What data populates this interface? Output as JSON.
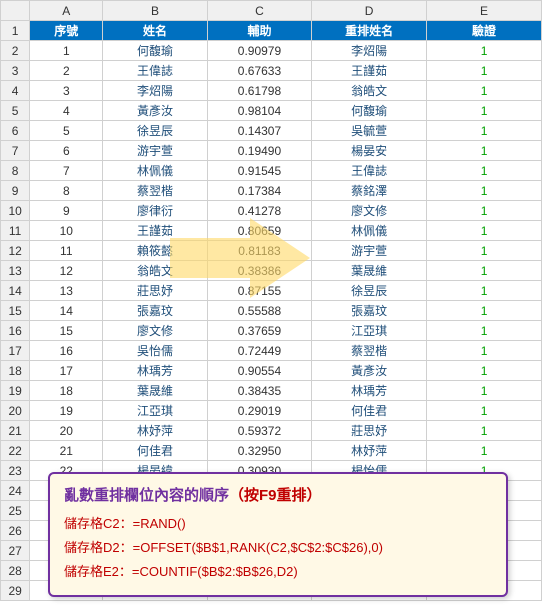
{
  "columns": [
    "A",
    "B",
    "C",
    "D",
    "E"
  ],
  "header": {
    "seq": "序號",
    "name": "姓名",
    "aux": "輔助",
    "reorder": "重排姓名",
    "verify": "驗證"
  },
  "rows": [
    {
      "r": 2,
      "seq": "1",
      "name": "何馥瑜",
      "aux": "0.90979",
      "reorder": "李炤陽",
      "verify": "1"
    },
    {
      "r": 3,
      "seq": "2",
      "name": "王偉誌",
      "aux": "0.67633",
      "reorder": "王謹茹",
      "verify": "1"
    },
    {
      "r": 4,
      "seq": "3",
      "name": "李炤陽",
      "aux": "0.61798",
      "reorder": "翁皓文",
      "verify": "1"
    },
    {
      "r": 5,
      "seq": "4",
      "name": "黃彥汝",
      "aux": "0.98104",
      "reorder": "何馥瑜",
      "verify": "1"
    },
    {
      "r": 6,
      "seq": "5",
      "name": "徐昱辰",
      "aux": "0.14307",
      "reorder": "吳毓萱",
      "verify": "1"
    },
    {
      "r": 7,
      "seq": "6",
      "name": "游宇萱",
      "aux": "0.19490",
      "reorder": "楊晏安",
      "verify": "1"
    },
    {
      "r": 8,
      "seq": "7",
      "name": "林佩儀",
      "aux": "0.91545",
      "reorder": "王偉誌",
      "verify": "1"
    },
    {
      "r": 9,
      "seq": "8",
      "name": "蔡翌楷",
      "aux": "0.17384",
      "reorder": "蔡銘澤",
      "verify": "1"
    },
    {
      "r": 10,
      "seq": "9",
      "name": "廖律衍",
      "aux": "0.41278",
      "reorder": "廖文修",
      "verify": "1"
    },
    {
      "r": 11,
      "seq": "10",
      "name": "王謹茹",
      "aux": "0.80659",
      "reorder": "林佩儀",
      "verify": "1"
    },
    {
      "r": 12,
      "seq": "11",
      "name": "賴筱懿",
      "aux": "0.81183",
      "reorder": "游宇萱",
      "verify": "1"
    },
    {
      "r": 13,
      "seq": "12",
      "name": "翁皓文",
      "aux": "0.38386",
      "reorder": "葉晟維",
      "verify": "1"
    },
    {
      "r": 14,
      "seq": "13",
      "name": "莊思妤",
      "aux": "0.87155",
      "reorder": "徐昱辰",
      "verify": "1"
    },
    {
      "r": 15,
      "seq": "14",
      "name": "張嘉玟",
      "aux": "0.55588",
      "reorder": "張嘉玟",
      "verify": "1"
    },
    {
      "r": 16,
      "seq": "15",
      "name": "廖文修",
      "aux": "0.37659",
      "reorder": "江亞琪",
      "verify": "1"
    },
    {
      "r": 17,
      "seq": "16",
      "name": "吳怡儒",
      "aux": "0.72449",
      "reorder": "蔡翌楷",
      "verify": "1"
    },
    {
      "r": 18,
      "seq": "17",
      "name": "林瑀芳",
      "aux": "0.90554",
      "reorder": "黃彥汝",
      "verify": "1"
    },
    {
      "r": 19,
      "seq": "18",
      "name": "葉晟維",
      "aux": "0.38435",
      "reorder": "林瑀芳",
      "verify": "1"
    },
    {
      "r": 20,
      "seq": "19",
      "name": "江亞琪",
      "aux": "0.29019",
      "reorder": "何佳君",
      "verify": "1"
    },
    {
      "r": 21,
      "seq": "20",
      "name": "林妤萍",
      "aux": "0.59372",
      "reorder": "莊思妤",
      "verify": "1"
    },
    {
      "r": 22,
      "seq": "21",
      "name": "何佳君",
      "aux": "0.32950",
      "reorder": "林妤萍",
      "verify": "1"
    },
    {
      "r": 23,
      "seq": "22",
      "name": "楊晏緯",
      "aux": "0.30930",
      "reorder": "楊怡儒",
      "verify": "1"
    }
  ],
  "emptyRows": [
    24,
    25,
    26,
    27,
    28,
    29
  ],
  "note": {
    "title_a": "亂數重排欄位內容的順序",
    "title_b": "（按F9重排）",
    "line1": "儲存格C2：=RAND()",
    "line2": "儲存格D2：=OFFSET($B$1,RANK(C2,$C$2:$C$26),0)",
    "line3": "儲存格E2：=COUNTIF($B$2:$B$26,D2)"
  }
}
